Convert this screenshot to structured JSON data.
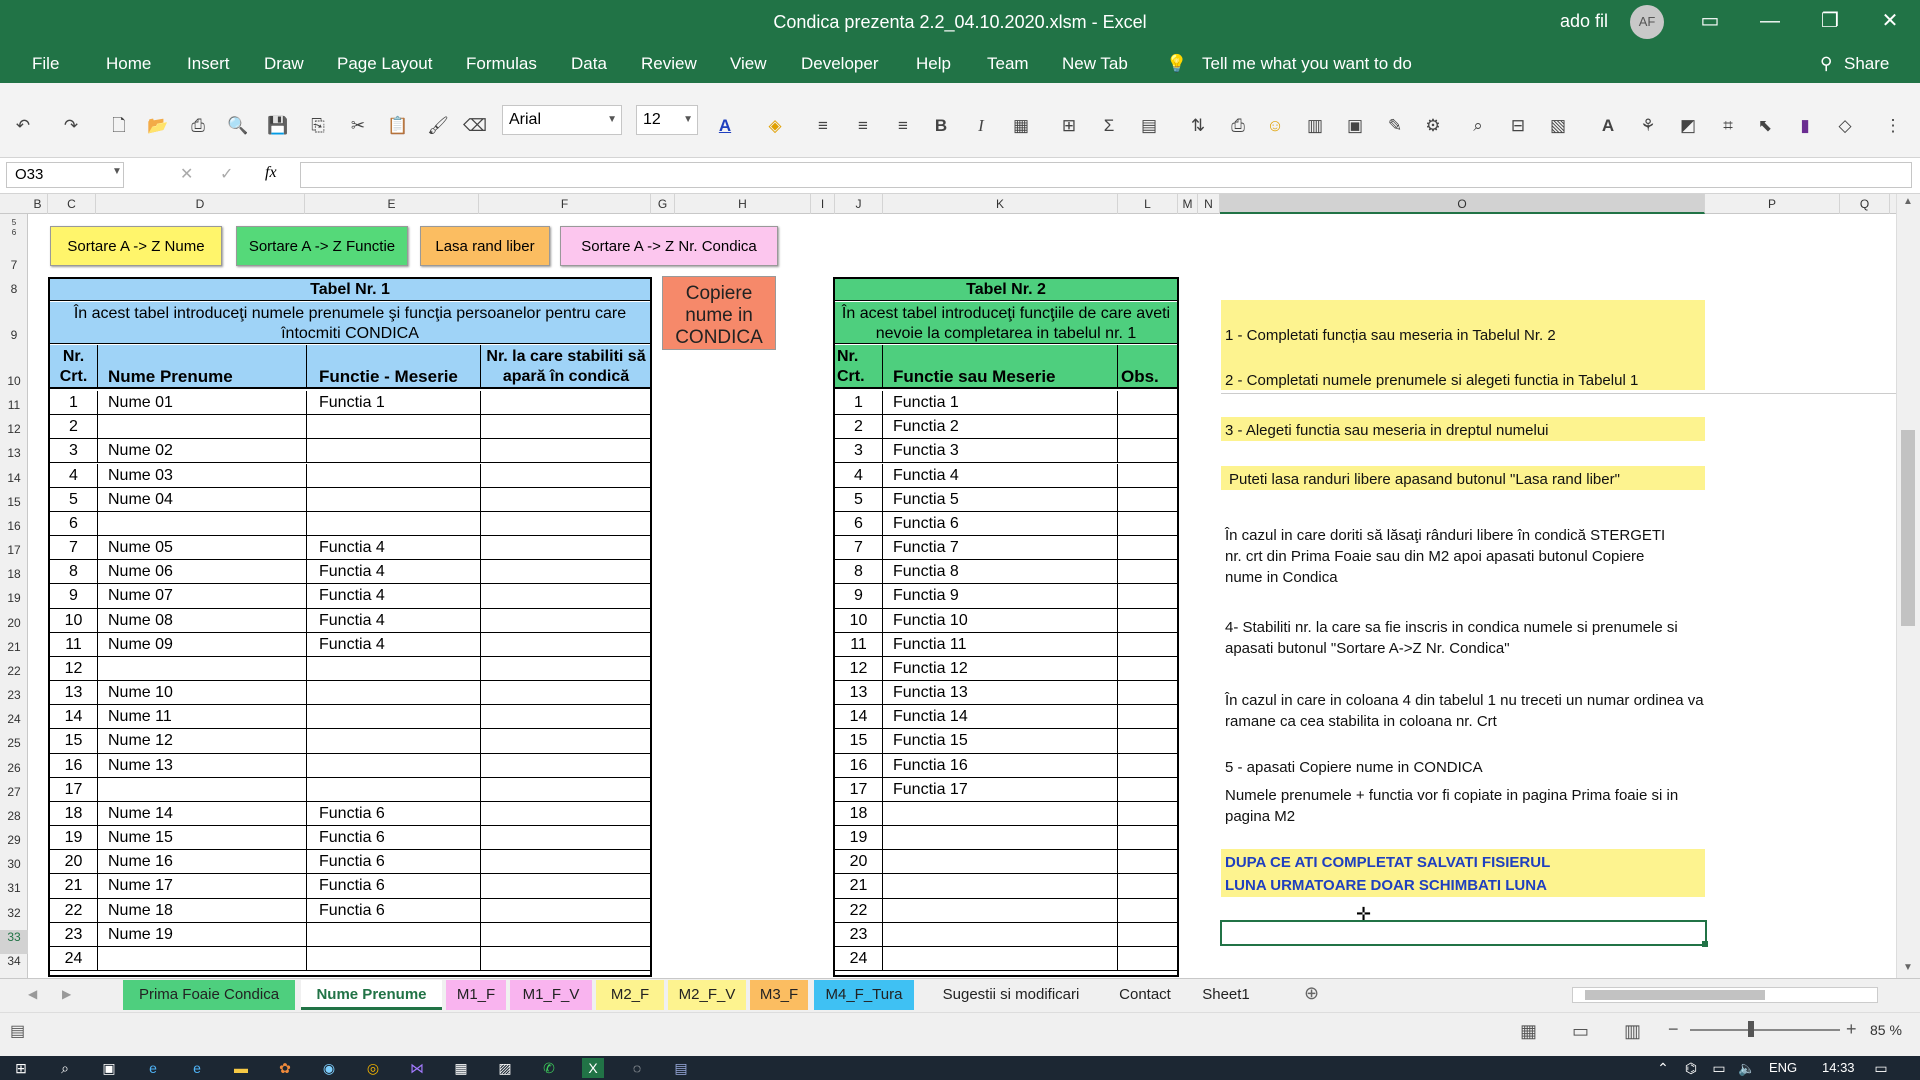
{
  "title": "Condica prezenta 2.2_04.10.2020.xlsm  -  Excel",
  "user": "ado fil",
  "avatar": "AF",
  "menu": [
    "File",
    "Home",
    "Insert",
    "Draw",
    "Page Layout",
    "Formulas",
    "Data",
    "Review",
    "View",
    "Developer",
    "Help",
    "Team",
    "New Tab"
  ],
  "tell": "Tell me what you want to do",
  "share": "Share",
  "font": "Arial",
  "size": "12",
  "namebox": "O33",
  "fx": "fx",
  "cols": [
    "B",
    "C",
    "D",
    "E",
    "F",
    "G",
    "H",
    "I",
    "J",
    "K",
    "L",
    "M",
    "N",
    "O",
    "P",
    "Q"
  ],
  "rows": [
    "5",
    "6",
    "7",
    "8",
    "9",
    "10",
    "11",
    "12",
    "13",
    "14",
    "15",
    "16",
    "17",
    "18",
    "19",
    "20",
    "21",
    "22",
    "23",
    "24",
    "25",
    "26",
    "27",
    "28",
    "29",
    "30",
    "31",
    "32",
    "33",
    "34"
  ],
  "buttons": {
    "sort_name": "Sortare A -> Z Nume",
    "sort_func": "Sortare A -> Z Functie",
    "free_row": "Lasa rand liber",
    "sort_nr": "Sortare A -> Z Nr. Condica",
    "copy": "Copiere nume in CONDICA"
  },
  "t1": {
    "title": "Tabel Nr. 1",
    "desc": "În acest tabel introduceţi numele prenumele şi funcţia persoanelor pentru care întocmiti CONDICA",
    "h_nr": "Nr. Crt.",
    "h_name": "Nume Prenume",
    "h_func": "Functie - Meserie",
    "h_cond": "Nr. la care stabiliti să apară în condică",
    "rows": [
      [
        "1",
        "Nume 01",
        "Functia 1"
      ],
      [
        "2",
        "",
        ""
      ],
      [
        "3",
        "Nume 02",
        ""
      ],
      [
        "4",
        "Nume 03",
        ""
      ],
      [
        "5",
        "Nume 04",
        ""
      ],
      [
        "6",
        "",
        ""
      ],
      [
        "7",
        "Nume 05",
        "Functia 4"
      ],
      [
        "8",
        "Nume 06",
        "Functia 4"
      ],
      [
        "9",
        "Nume 07",
        "Functia 4"
      ],
      [
        "10",
        "Nume 08",
        "Functia 4"
      ],
      [
        "11",
        "Nume 09",
        "Functia 4"
      ],
      [
        "12",
        "",
        ""
      ],
      [
        "13",
        "Nume 10",
        ""
      ],
      [
        "14",
        "Nume 11",
        ""
      ],
      [
        "15",
        "Nume 12",
        ""
      ],
      [
        "16",
        "Nume 13",
        ""
      ],
      [
        "17",
        "",
        ""
      ],
      [
        "18",
        "Nume 14",
        "Functia 6"
      ],
      [
        "19",
        "Nume 15",
        "Functia 6"
      ],
      [
        "20",
        "Nume 16",
        "Functia 6"
      ],
      [
        "21",
        "Nume 17",
        "Functia 6"
      ],
      [
        "22",
        "Nume 18",
        "Functia 6"
      ],
      [
        "23",
        "Nume 19",
        ""
      ],
      [
        "24",
        "",
        ""
      ]
    ]
  },
  "t2": {
    "title": "Tabel Nr. 2",
    "desc": "În acest tabel introduceţi  funcţiile de care aveti nevoie la completarea in tabelul nr. 1",
    "h_nr": "Nr. Crt.",
    "h_func": "Functie sau Meserie",
    "h_obs": "Obs.",
    "rows": [
      [
        "1",
        "Functia 1"
      ],
      [
        "2",
        "Functia 2"
      ],
      [
        "3",
        "Functia 3"
      ],
      [
        "4",
        "Functia 4"
      ],
      [
        "5",
        "Functia 5"
      ],
      [
        "6",
        "Functia 6"
      ],
      [
        "7",
        "Functia 7"
      ],
      [
        "8",
        "Functia 8"
      ],
      [
        "9",
        "Functia 9"
      ],
      [
        "10",
        "Functia 10"
      ],
      [
        "11",
        "Functia 11"
      ],
      [
        "12",
        "Functia 12"
      ],
      [
        "13",
        "Functia 13"
      ],
      [
        "14",
        "Functia 14"
      ],
      [
        "15",
        "Functia 15"
      ],
      [
        "16",
        "Functia 16"
      ],
      [
        "17",
        "Functia 17"
      ],
      [
        "18",
        ""
      ],
      [
        "19",
        ""
      ],
      [
        "20",
        ""
      ],
      [
        "21",
        ""
      ],
      [
        "22",
        ""
      ],
      [
        "23",
        ""
      ],
      [
        "24",
        ""
      ]
    ]
  },
  "instructions": {
    "i1": "1 - Completati funcția sau meseria in Tabelul Nr. 2",
    "i2": "2 - Completati numele prenumele si alegeti functia in Tabelul 1",
    "i3": "3 - Alegeti functia sau meseria in dreptul numelui",
    "i4": "Puteti lasa randuri libere apasand butonul \"Lasa rand liber\"",
    "i5": "În cazul in care doriti să lăsaţi rânduri libere în condică STERGETI nr. crt din Prima Foaie sau din M2 apoi apasati butonul Copiere nume in Condica",
    "i6": "4- Stabiliti nr. la care sa fie inscris in condica numele si prenumele si apasati butonul \"Sortare A->Z Nr. Condica\"",
    "i7": "În cazul in care in coloana 4 din tabelul 1 nu treceti un numar ordinea va ramane ca cea stabilita in coloana nr. Crt",
    "i8": "5 - apasati Copiere nume in CONDICA",
    "i9": "Numele prenumele + functia vor fi copiate in pagina Prima foaie si in pagina M2",
    "i10a": "DUPA CE ATI COMPLETAT SALVATI FISIERUL",
    "i10b": "LUNA URMATOARE DOAR SCHIMBATI LUNA"
  },
  "tabs": [
    "Prima Foaie Condica",
    "Nume Prenume",
    "M1_F",
    "M1_F_V",
    "M2_F",
    "M2_F_V",
    "M3_F",
    "M4_F_Tura",
    "Sugestii si modificari",
    "Contact",
    "Sheet1"
  ],
  "zoom": "85 %",
  "lang": "ENG",
  "time": "14:33",
  "colors": {
    "excel_green": "#217346",
    "t1_blue": "#9fd3f7",
    "t2_green": "#4ecf7e",
    "yellow": "#fdf38f",
    "copy_orange": "#f6896a"
  }
}
